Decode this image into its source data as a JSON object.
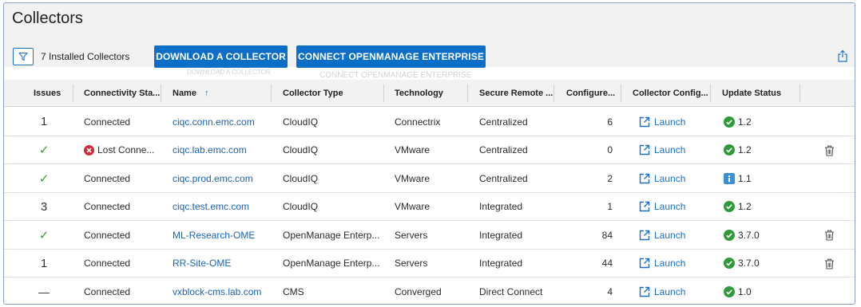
{
  "page": {
    "title": "Collectors"
  },
  "toolbar": {
    "filter_icon": "filter-icon",
    "count_text": "7 Installed Collectors",
    "download_label": "DOWNLOAD A COLLECTOR",
    "connect_label": "CONNECT OPENMANAGE ENTERPRISE",
    "download_ghost": "DOWNLOAD A COLLECTOR",
    "connect_ghost": "CONNECT OPENMANAGE ENTERPRISE",
    "export_icon": "export-icon"
  },
  "table": {
    "columns": {
      "issues": "Issues",
      "connectivity": "Connectivity Sta...",
      "name": "Name",
      "name_sort": "↑",
      "collector_type": "Collector Type",
      "technology": "Technology",
      "secure_remote": "Secure Remote ...",
      "configured": "Configure...",
      "collector_config": "Collector Config...",
      "update_status": "Update Status"
    },
    "rows": [
      {
        "issues": "1",
        "issue_kind": "number",
        "connectivity": "Connected",
        "conn_error": false,
        "name": "ciqc.conn.emc.com",
        "type": "CloudIQ",
        "technology": "Connectrix",
        "secure": "Centralized",
        "configured": "6",
        "config": "Launch",
        "update": "1.2",
        "update_kind": "ok",
        "trash": false
      },
      {
        "issues": "✓",
        "issue_kind": "check",
        "connectivity": "Lost Conne...",
        "conn_error": true,
        "name": "ciqc.lab.emc.com",
        "type": "CloudIQ",
        "technology": "VMware",
        "secure": "Centralized",
        "configured": "0",
        "config": "Launch",
        "update": "1.2",
        "update_kind": "ok",
        "trash": true
      },
      {
        "issues": "✓",
        "issue_kind": "check",
        "connectivity": "Connected",
        "conn_error": false,
        "name": "ciqc.prod.emc.com",
        "type": "CloudIQ",
        "technology": "VMware",
        "secure": "Centralized",
        "configured": "2",
        "config": "Launch",
        "update": "1.1",
        "update_kind": "info",
        "trash": false
      },
      {
        "issues": "3",
        "issue_kind": "number",
        "connectivity": "Connected",
        "conn_error": false,
        "name": "ciqc.test.emc.com",
        "type": "CloudIQ",
        "technology": "VMware",
        "secure": "Integrated",
        "configured": "1",
        "config": "Launch",
        "update": "1.2",
        "update_kind": "ok",
        "trash": false
      },
      {
        "issues": "✓",
        "issue_kind": "check",
        "connectivity": "Connected",
        "conn_error": false,
        "name": "ML-Research-OME",
        "type": "OpenManage Enterp...",
        "technology": "Servers",
        "secure": "Integrated",
        "configured": "84",
        "config": "Launch",
        "update": "3.7.0",
        "update_kind": "ok",
        "trash": true
      },
      {
        "issues": "1",
        "issue_kind": "number",
        "connectivity": "Connected",
        "conn_error": false,
        "name": "RR-Site-OME",
        "type": "OpenManage Enterp...",
        "technology": "Servers",
        "secure": "Integrated",
        "configured": "44",
        "config": "Launch",
        "update": "3.7.0",
        "update_kind": "ok",
        "trash": true
      },
      {
        "issues": "—",
        "issue_kind": "dash",
        "connectivity": "Connected",
        "conn_error": false,
        "name": "vxblock-cms.lab.com",
        "type": "CMS",
        "technology": "Converged",
        "secure": "Direct Connect",
        "configured": "4",
        "config": "Launch",
        "update": "1.0",
        "update_kind": "ok",
        "trash": false
      }
    ]
  },
  "colors": {
    "accent": "#0b6fc7",
    "link": "#1a63b8",
    "ok_green": "#2e9a3a",
    "check_green": "#3a9a3a",
    "error_red": "#d2283c",
    "info_blue": "#3a8fd6",
    "header_bg": "#f2f2f2"
  }
}
